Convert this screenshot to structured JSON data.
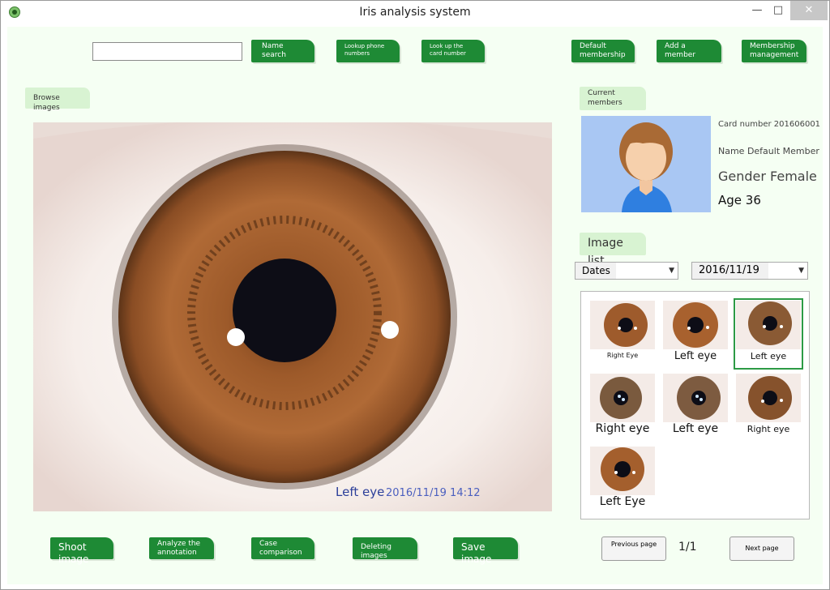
{
  "window": {
    "title": "Iris analysis system",
    "min_glyph": "—",
    "max_glyph": "□",
    "close_glyph": "✕"
  },
  "toolbar": {
    "search_value": "",
    "name_search": "Name search",
    "lookup_phone": "Lookup phone numbers",
    "lookup_card": "Look up the card number",
    "default_membership": "Default membership",
    "add_member": "Add a member",
    "membership_management": "Membership management"
  },
  "viewer": {
    "browse_label": "Browse images",
    "eye_label": "Left eye",
    "date_time": "2016/11/19 14:12"
  },
  "member": {
    "section_label": "Current members",
    "card_number": "Card number 201606001",
    "name": "Name Default Member",
    "gender": "Gender Female",
    "age": "Age 36"
  },
  "image_list": {
    "section_label": "Image list",
    "filter_type": "Dates",
    "filter_date": "2016/11/19",
    "thumbnails": [
      {
        "label": "Right Eye"
      },
      {
        "label": "Left eye"
      },
      {
        "label": "Left eye"
      },
      {
        "label": "Right eye"
      },
      {
        "label": "Left eye"
      },
      {
        "label": "Right eye"
      },
      {
        "label": "Left Eye"
      }
    ]
  },
  "actions": {
    "shoot": "Shoot image",
    "analyze": "Analyze the annotation",
    "compare": "Case comparison",
    "delete": "Deleting images",
    "save": "Save image"
  },
  "pager": {
    "previous": "Previous page",
    "page": "1/1",
    "next": "Next page"
  },
  "colors": {
    "accent_green": "#1e8a35",
    "light_green": "#d8f3d2",
    "iris_brown": "#a4622e",
    "caption_blue": "#2c3f9a"
  }
}
